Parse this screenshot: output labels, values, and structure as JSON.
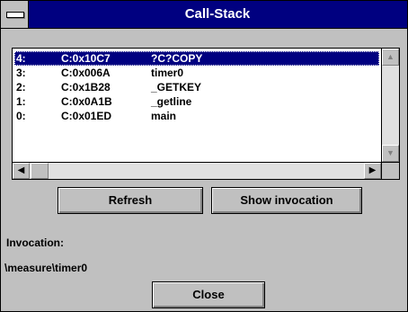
{
  "window": {
    "title": "Call-Stack"
  },
  "call_stack": {
    "rows": [
      {
        "level": "4:",
        "address": "C:0x10C7",
        "function": "?C?COPY",
        "selected": true
      },
      {
        "level": "3:",
        "address": "C:0x006A",
        "function": "timer0",
        "selected": false
      },
      {
        "level": "2:",
        "address": "C:0x1B28",
        "function": "_GETKEY",
        "selected": false
      },
      {
        "level": "1:",
        "address": "C:0x0A1B",
        "function": "_getline",
        "selected": false
      },
      {
        "level": "0:",
        "address": "C:0x01ED",
        "function": "main",
        "selected": false
      }
    ]
  },
  "buttons": {
    "refresh": "Refresh",
    "show_invocation": "Show invocation",
    "close": "Close"
  },
  "invocation": {
    "label": "Invocation:",
    "value": "\\measure\\timer0"
  },
  "icons": {
    "scroll_up": "scroll-up-icon",
    "scroll_down": "scroll-down-icon",
    "scroll_left": "scroll-left-icon",
    "scroll_right": "scroll-right-icon"
  },
  "colors": {
    "titlebar": "#000080",
    "selection": "#000080",
    "face": "#c0c0c0"
  }
}
